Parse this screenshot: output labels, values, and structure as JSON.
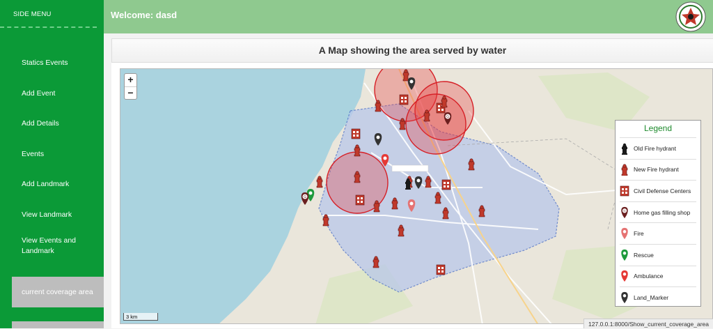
{
  "sidebar": {
    "title": "SIDE MENU",
    "items": [
      {
        "label": "Statics Events"
      },
      {
        "label": "Add Event"
      },
      {
        "label": "Add Details"
      },
      {
        "label": "Events"
      },
      {
        "label": "Add Landmark"
      },
      {
        "label": "View Landmark"
      },
      {
        "label": "View Events and Landmark"
      },
      {
        "label": "current coverage area"
      }
    ]
  },
  "header": {
    "welcome": "Welcome: dasd"
  },
  "panel": {
    "title": "A Map showing the area served by water"
  },
  "map": {
    "zoom_in": "+",
    "zoom_out": "−",
    "scale": "3 km"
  },
  "legend": {
    "title": "Legend",
    "items": [
      {
        "label": "Old Fire hydrant",
        "icon": "old-hydrant-icon",
        "color": "#1a1a1a"
      },
      {
        "label": "New Fire hydrant",
        "icon": "new-hydrant-icon",
        "color": "#c0392b"
      },
      {
        "label": "Civil Defense Centers",
        "icon": "civil-defense-icon",
        "color": "#c0392b"
      },
      {
        "label": "Home gas filling shop",
        "icon": "gas-shop-icon",
        "color": "#6b1f1f"
      },
      {
        "label": "Fire",
        "icon": "fire-pin-icon",
        "color": "#e88080"
      },
      {
        "label": "Rescue",
        "icon": "rescue-pin-icon",
        "color": "#1e9a3c"
      },
      {
        "label": "Ambulance",
        "icon": "ambulance-pin-icon",
        "color": "#e53935"
      },
      {
        "label": "Land_Marker",
        "icon": "landmark-pin-icon",
        "color": "#333333"
      }
    ]
  },
  "status": {
    "url": "127.0.0.1:8000/Show_current_coverage_area"
  },
  "colors": {
    "sidebar": "#0b9a37",
    "header": "#8fc98f",
    "legend_title": "#1e8a2d"
  }
}
